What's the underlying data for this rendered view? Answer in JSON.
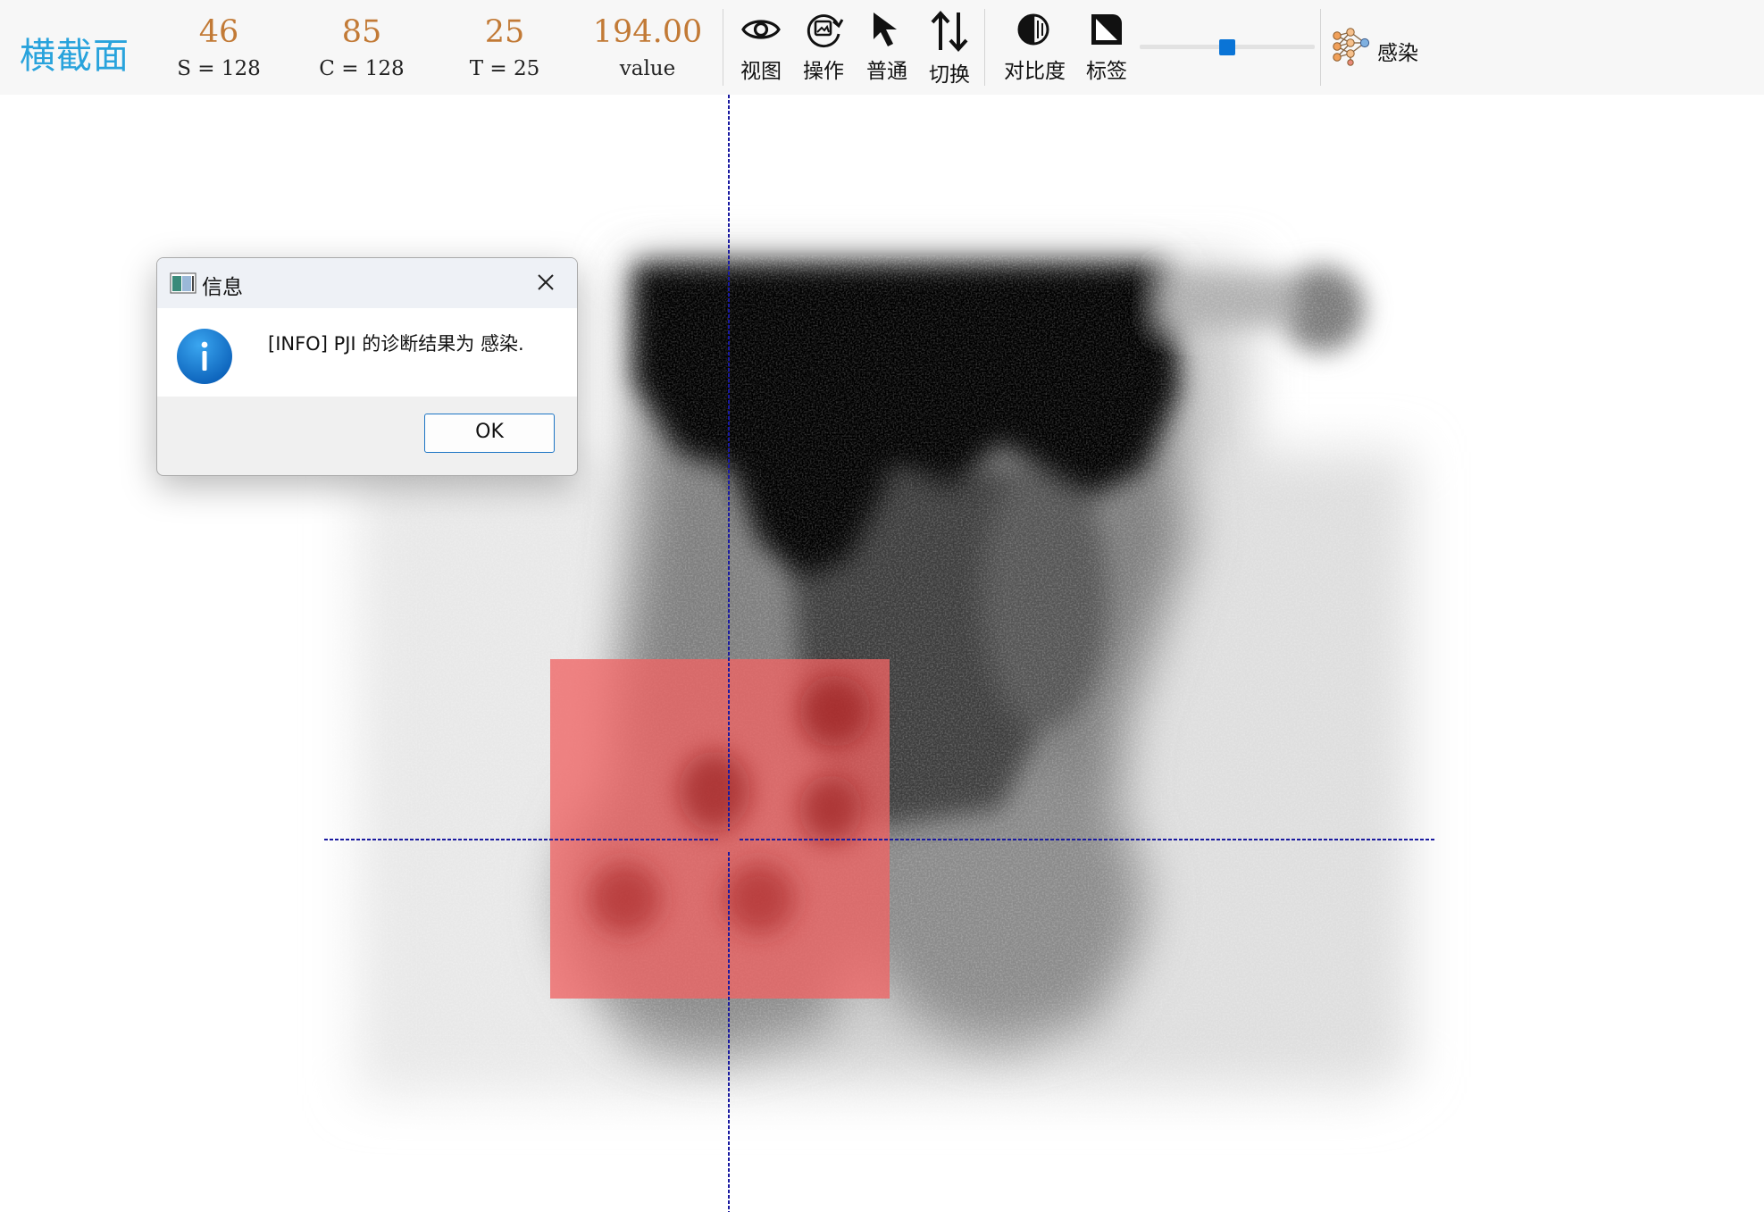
{
  "toolbar": {
    "view_title": "横截面",
    "stats": [
      {
        "value": "46",
        "label": "S = 128"
      },
      {
        "value": "85",
        "label": "C = 128"
      },
      {
        "value": "25",
        "label": "T = 25"
      },
      {
        "value": "194.00",
        "label": "value"
      }
    ],
    "tools": [
      {
        "label": "视图",
        "icon": "eye-icon"
      },
      {
        "label": "操作",
        "icon": "image-rotate-icon"
      },
      {
        "label": "普通",
        "icon": "cursor-arrow-icon"
      },
      {
        "label": "切换",
        "icon": "swap-vertical-icon"
      },
      {
        "label": "对比度",
        "icon": "contrast-icon"
      },
      {
        "label": "标签",
        "icon": "label-tag-icon"
      }
    ],
    "slider": {
      "level": 0.5
    },
    "infection": {
      "label": "感染",
      "icon": "neural-network-icon"
    }
  },
  "dialog": {
    "title": "信息",
    "message": "[INFO] PJI 的诊断结果为 感染.",
    "ok_label": "OK",
    "icon": "info-icon"
  },
  "colors": {
    "title_blue": "#29a3dc",
    "stat_orange": "#c27a36",
    "crosshair": "#1a1aa0",
    "overlay_red": "#f06464",
    "accent": "#0a74d6"
  }
}
